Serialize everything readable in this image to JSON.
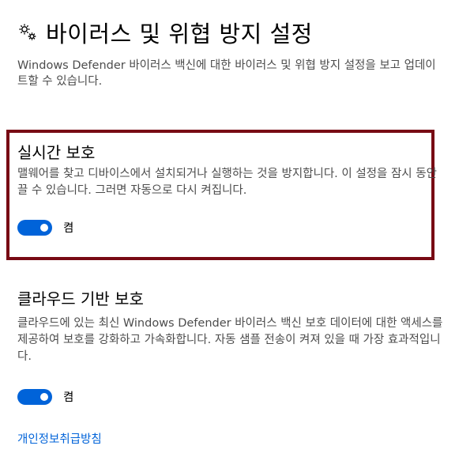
{
  "header": {
    "icon": "gear-icon",
    "title": "바이러스 및 위협 방지 설정",
    "description": "Windows Defender 바이러스 백신에 대한 바이러스 및 위협 방지 설정을 보고 업데이트할 수 있습니다."
  },
  "realtime": {
    "title": "실시간 보호",
    "description": "맬웨어를 찾고 디바이스에서 설치되거나 실행하는 것을 방지합니다. 이 설정을 잠시 동안 끌 수 있습니다. 그러면 자동으로 다시 켜집니다.",
    "toggle_state": "켬",
    "toggle_on": true
  },
  "cloud": {
    "title": "클라우드 기반 보호",
    "description": "클라우드에 있는 최신 Windows Defender 바이러스 백신 보호 데이터에 대한 액세스를 제공하여 보호를 강화하고 가속화합니다. 자동 샘플 전송이 켜져 있을 때 가장 효과적입니다.",
    "toggle_state": "켬",
    "toggle_on": true
  },
  "privacy_link": "개인정보취급방침",
  "colors": {
    "accent": "#0063d9",
    "highlight_border": "#780a14",
    "secondary_text": "#4c4c4c"
  }
}
